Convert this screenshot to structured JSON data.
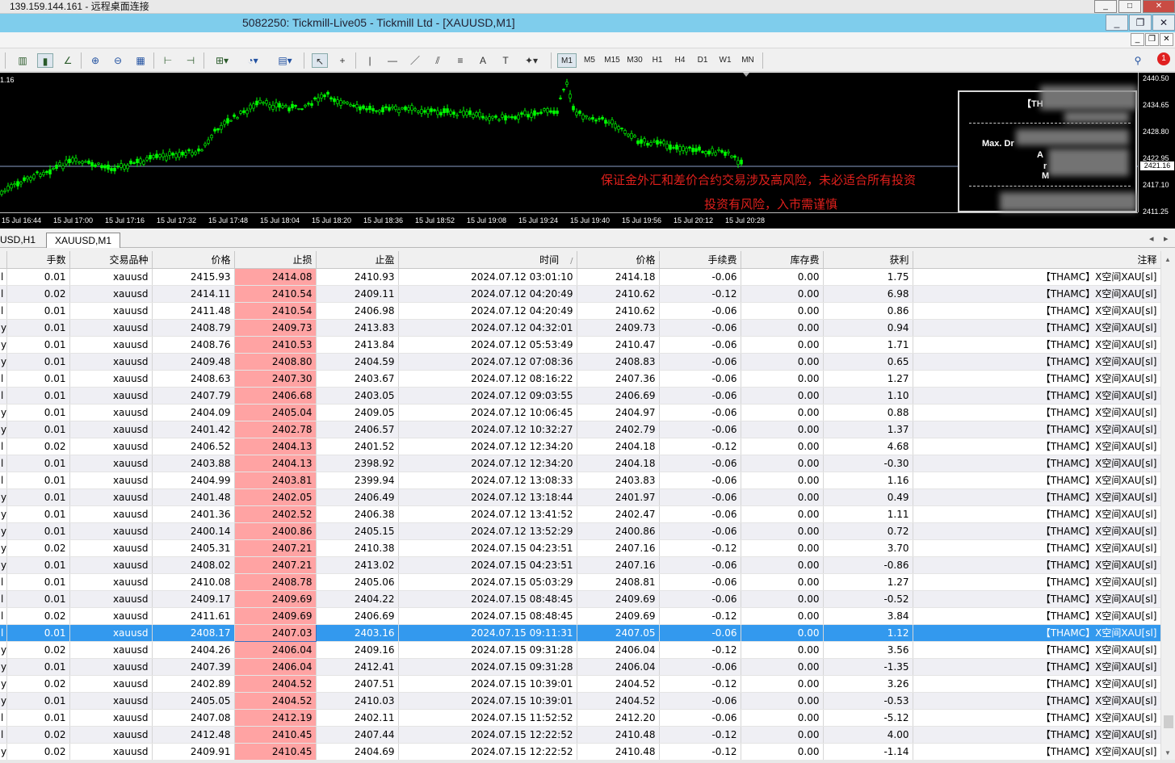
{
  "rdp": {
    "title": "139.159.144.161 - 远程桌面连接",
    "btn_min": "_",
    "btn_max": "□",
    "btn_close": "✕"
  },
  "window": {
    "title": "5082250: Tickmill-Live05 - Tickmill Ltd - [XAUUSD,M1]",
    "btn_min": "_",
    "btn_restore": "❐",
    "btn_close": "✕"
  },
  "toolbar": {
    "timeframes": [
      "M1",
      "M5",
      "M15",
      "M30",
      "H1",
      "H4",
      "D1",
      "W1",
      "MN"
    ],
    "active_tf": "M1",
    "notification_count": "1"
  },
  "chart": {
    "left_label": "1.16",
    "warning_line1": "保证金外汇和差价合约交易涉及高风险，未必适合所有投资",
    "warning_line2": "投资有风险，入市需谨慎",
    "panel_title": "【TH",
    "panel_max_dd": "Max. Dr",
    "panel_a": "A",
    "panel_r": "r",
    "panel_m": "M",
    "price_labels": [
      "2440.50",
      "2434.65",
      "2428.80",
      "2422.95",
      "2417.10",
      "2411.25"
    ],
    "current_price": "2421.16",
    "time_labels": [
      "15 Jul 16:44",
      "15 Jul 17:00",
      "15 Jul 17:16",
      "15 Jul 17:32",
      "15 Jul 17:48",
      "15 Jul 18:04",
      "15 Jul 18:20",
      "15 Jul 18:36",
      "15 Jul 18:52",
      "15 Jul 19:08",
      "15 Jul 19:24",
      "15 Jul 19:40",
      "15 Jul 19:56",
      "15 Jul 20:12",
      "15 Jul 20:28"
    ]
  },
  "tabs": {
    "t1": "USD,H1",
    "t2": "XAUUSD,M1",
    "left_arrow": "◂",
    "right_arrow": "▸"
  },
  "table": {
    "headers": [
      "",
      "手数",
      "交易品种",
      "价格",
      "止损",
      "止盈",
      "时间",
      "价格",
      "手续费",
      "库存费",
      "获利",
      "注释"
    ],
    "sort_mark": "/",
    "rows": [
      [
        "l",
        "0.01",
        "xauusd",
        "2415.93",
        "2414.08",
        "2410.93",
        "2024.07.12 03:01:10",
        "2414.18",
        "-0.06",
        "0.00",
        "1.75",
        "【THAMC】X空间XAU[sl]"
      ],
      [
        "l",
        "0.02",
        "xauusd",
        "2414.11",
        "2410.54",
        "2409.11",
        "2024.07.12 04:20:49",
        "2410.62",
        "-0.12",
        "0.00",
        "6.98",
        "【THAMC】X空间XAU[sl]"
      ],
      [
        "l",
        "0.01",
        "xauusd",
        "2411.48",
        "2410.54",
        "2406.98",
        "2024.07.12 04:20:49",
        "2410.62",
        "-0.06",
        "0.00",
        "0.86",
        "【THAMC】X空间XAU[sl]"
      ],
      [
        "y",
        "0.01",
        "xauusd",
        "2408.79",
        "2409.73",
        "2413.83",
        "2024.07.12 04:32:01",
        "2409.73",
        "-0.06",
        "0.00",
        "0.94",
        "【THAMC】X空间XAU[sl]"
      ],
      [
        "y",
        "0.01",
        "xauusd",
        "2408.76",
        "2410.53",
        "2413.84",
        "2024.07.12 05:53:49",
        "2410.47",
        "-0.06",
        "0.00",
        "1.71",
        "【THAMC】X空间XAU[sl]"
      ],
      [
        "y",
        "0.01",
        "xauusd",
        "2409.48",
        "2408.80",
        "2404.59",
        "2024.07.12 07:08:36",
        "2408.83",
        "-0.06",
        "0.00",
        "0.65",
        "【THAMC】X空间XAU[sl]"
      ],
      [
        "l",
        "0.01",
        "xauusd",
        "2408.63",
        "2407.30",
        "2403.67",
        "2024.07.12 08:16:22",
        "2407.36",
        "-0.06",
        "0.00",
        "1.27",
        "【THAMC】X空间XAU[sl]"
      ],
      [
        "l",
        "0.01",
        "xauusd",
        "2407.79",
        "2406.68",
        "2403.05",
        "2024.07.12 09:03:55",
        "2406.69",
        "-0.06",
        "0.00",
        "1.10",
        "【THAMC】X空间XAU[sl]"
      ],
      [
        "y",
        "0.01",
        "xauusd",
        "2404.09",
        "2405.04",
        "2409.05",
        "2024.07.12 10:06:45",
        "2404.97",
        "-0.06",
        "0.00",
        "0.88",
        "【THAMC】X空间XAU[sl]"
      ],
      [
        "y",
        "0.01",
        "xauusd",
        "2401.42",
        "2402.78",
        "2406.57",
        "2024.07.12 10:32:27",
        "2402.79",
        "-0.06",
        "0.00",
        "1.37",
        "【THAMC】X空间XAU[sl]"
      ],
      [
        "l",
        "0.02",
        "xauusd",
        "2406.52",
        "2404.13",
        "2401.52",
        "2024.07.12 12:34:20",
        "2404.18",
        "-0.12",
        "0.00",
        "4.68",
        "【THAMC】X空间XAU[sl]"
      ],
      [
        "l",
        "0.01",
        "xauusd",
        "2403.88",
        "2404.13",
        "2398.92",
        "2024.07.12 12:34:20",
        "2404.18",
        "-0.06",
        "0.00",
        "-0.30",
        "【THAMC】X空间XAU[sl]"
      ],
      [
        "l",
        "0.01",
        "xauusd",
        "2404.99",
        "2403.81",
        "2399.94",
        "2024.07.12 13:08:33",
        "2403.83",
        "-0.06",
        "0.00",
        "1.16",
        "【THAMC】X空间XAU[sl]"
      ],
      [
        "y",
        "0.01",
        "xauusd",
        "2401.48",
        "2402.05",
        "2406.49",
        "2024.07.12 13:18:44",
        "2401.97",
        "-0.06",
        "0.00",
        "0.49",
        "【THAMC】X空间XAU[sl]"
      ],
      [
        "y",
        "0.01",
        "xauusd",
        "2401.36",
        "2402.52",
        "2406.38",
        "2024.07.12 13:41:52",
        "2402.47",
        "-0.06",
        "0.00",
        "1.11",
        "【THAMC】X空间XAU[sl]"
      ],
      [
        "y",
        "0.01",
        "xauusd",
        "2400.14",
        "2400.86",
        "2405.15",
        "2024.07.12 13:52:29",
        "2400.86",
        "-0.06",
        "0.00",
        "0.72",
        "【THAMC】X空间XAU[sl]"
      ],
      [
        "y",
        "0.02",
        "xauusd",
        "2405.31",
        "2407.21",
        "2410.38",
        "2024.07.15 04:23:51",
        "2407.16",
        "-0.12",
        "0.00",
        "3.70",
        "【THAMC】X空间XAU[sl]"
      ],
      [
        "y",
        "0.01",
        "xauusd",
        "2408.02",
        "2407.21",
        "2413.02",
        "2024.07.15 04:23:51",
        "2407.16",
        "-0.06",
        "0.00",
        "-0.86",
        "【THAMC】X空间XAU[sl]"
      ],
      [
        "l",
        "0.01",
        "xauusd",
        "2410.08",
        "2408.78",
        "2405.06",
        "2024.07.15 05:03:29",
        "2408.81",
        "-0.06",
        "0.00",
        "1.27",
        "【THAMC】X空间XAU[sl]"
      ],
      [
        "l",
        "0.01",
        "xauusd",
        "2409.17",
        "2409.69",
        "2404.22",
        "2024.07.15 08:48:45",
        "2409.69",
        "-0.06",
        "0.00",
        "-0.52",
        "【THAMC】X空间XAU[sl]"
      ],
      [
        "l",
        "0.02",
        "xauusd",
        "2411.61",
        "2409.69",
        "2406.69",
        "2024.07.15 08:48:45",
        "2409.69",
        "-0.12",
        "0.00",
        "3.84",
        "【THAMC】X空间XAU[sl]"
      ],
      [
        "l",
        "0.01",
        "xauusd",
        "2408.17",
        "2407.03",
        "2403.16",
        "2024.07.15 09:11:31",
        "2407.05",
        "-0.06",
        "0.00",
        "1.12",
        "【THAMC】X空间XAU[sl]"
      ],
      [
        "y",
        "0.02",
        "xauusd",
        "2404.26",
        "2406.04",
        "2409.16",
        "2024.07.15 09:31:28",
        "2406.04",
        "-0.12",
        "0.00",
        "3.56",
        "【THAMC】X空间XAU[sl]"
      ],
      [
        "y",
        "0.01",
        "xauusd",
        "2407.39",
        "2406.04",
        "2412.41",
        "2024.07.15 09:31:28",
        "2406.04",
        "-0.06",
        "0.00",
        "-1.35",
        "【THAMC】X空间XAU[sl]"
      ],
      [
        "y",
        "0.02",
        "xauusd",
        "2402.89",
        "2404.52",
        "2407.51",
        "2024.07.15 10:39:01",
        "2404.52",
        "-0.12",
        "0.00",
        "3.26",
        "【THAMC】X空间XAU[sl]"
      ],
      [
        "y",
        "0.01",
        "xauusd",
        "2405.05",
        "2404.52",
        "2410.03",
        "2024.07.15 10:39:01",
        "2404.52",
        "-0.06",
        "0.00",
        "-0.53",
        "【THAMC】X空间XAU[sl]"
      ],
      [
        "l",
        "0.01",
        "xauusd",
        "2407.08",
        "2412.19",
        "2402.11",
        "2024.07.15 11:52:52",
        "2412.20",
        "-0.06",
        "0.00",
        "-5.12",
        "【THAMC】X空间XAU[sl]"
      ],
      [
        "l",
        "0.02",
        "xauusd",
        "2412.48",
        "2410.45",
        "2407.44",
        "2024.07.15 12:22:52",
        "2410.48",
        "-0.12",
        "0.00",
        "4.00",
        "【THAMC】X空间XAU[sl]"
      ],
      [
        "y",
        "0.02",
        "xauusd",
        "2409.91",
        "2410.45",
        "2404.69",
        "2024.07.15 12:22:52",
        "2410.48",
        "-0.12",
        "0.00",
        "-1.14",
        "【THAMC】X空间XAU[sl]"
      ]
    ],
    "selected_row": 21
  }
}
